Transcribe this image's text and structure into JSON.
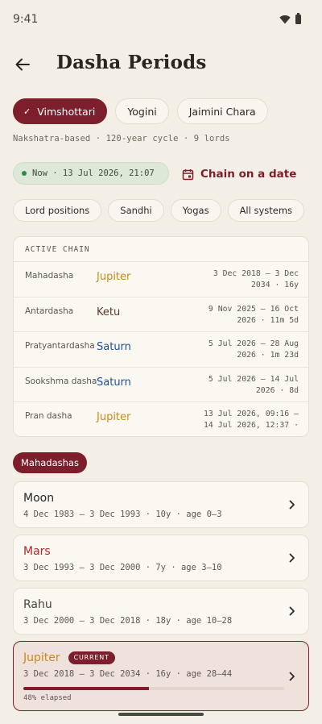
{
  "status_bar": {
    "time": "9:41"
  },
  "header": {
    "title": "Dasha Periods"
  },
  "systems": [
    {
      "label": "Vimshottari",
      "selected": true
    },
    {
      "label": "Yogini",
      "selected": false
    },
    {
      "label": "Jaimini Chara",
      "selected": false
    }
  ],
  "subtitle": "Nakshatra-based · 120-year cycle · 9 lords",
  "now_pill": "Now · 13 Jul 2026, 21:07",
  "chain_button": "Chain on a date",
  "filters": [
    "Lord positions",
    "Sandhi",
    "Yogas",
    "All systems"
  ],
  "active_chain": {
    "title": "ACTIVE CHAIN",
    "rows": [
      {
        "level": "Mahadasha",
        "lord": "Jupiter",
        "color": "#c98a1b",
        "range_line1": "3 Dec 2018 – 3 Dec",
        "range_line2": "2034 · 16y"
      },
      {
        "level": "Antardasha",
        "lord": "Ketu",
        "color": "#5b3a2a",
        "range_line1": "9 Nov 2025 – 16 Oct",
        "range_line2": "2026 · 11m 5d"
      },
      {
        "level": "Pratyantardasha",
        "lord": "Saturn",
        "color": "#1f4f9c",
        "range_line1": "5 Jul 2026 – 28 Aug",
        "range_line2": "2026 · 1m 23d"
      },
      {
        "level": "Sookshma dasha",
        "lord": "Saturn",
        "color": "#1f4f9c",
        "range_line1": "5 Jul 2026 – 14 Jul",
        "range_line2": "2026 · 8d"
      },
      {
        "level": "Pran dasha",
        "lord": "Jupiter",
        "color": "#c98a1b",
        "range_line1": "13 Jul 2026, 09:16 –",
        "range_line2": "14 Jul 2026, 12:37 ·"
      }
    ]
  },
  "mahadashas_label": "Mahadashas",
  "mahadashas": [
    {
      "lord": "Moon",
      "color": "#2b2724",
      "range": "4 Dec 1983 – 3 Dec 1993 · 10y · age 0–3"
    },
    {
      "lord": "Mars",
      "color": "#b0262c",
      "range": "3 Dec 1993 – 3 Dec 2000 · 7y · age 3–10"
    },
    {
      "lord": "Rahu",
      "color": "#4a4540",
      "range": "3 Dec 2000 – 3 Dec 2018 · 18y · age 10–28"
    },
    {
      "lord": "Jupiter",
      "color": "#c98a1b",
      "range": "3 Dec 2018 – 3 Dec 2034 · 16y · age 28–44",
      "current": true,
      "badge": "CURRENT",
      "progress": 0.48,
      "elapsed": "48% elapsed"
    }
  ],
  "colors": {
    "accent": "#7c1e2c",
    "background": "#f4efe6",
    "now_green": "#2f8a43"
  }
}
